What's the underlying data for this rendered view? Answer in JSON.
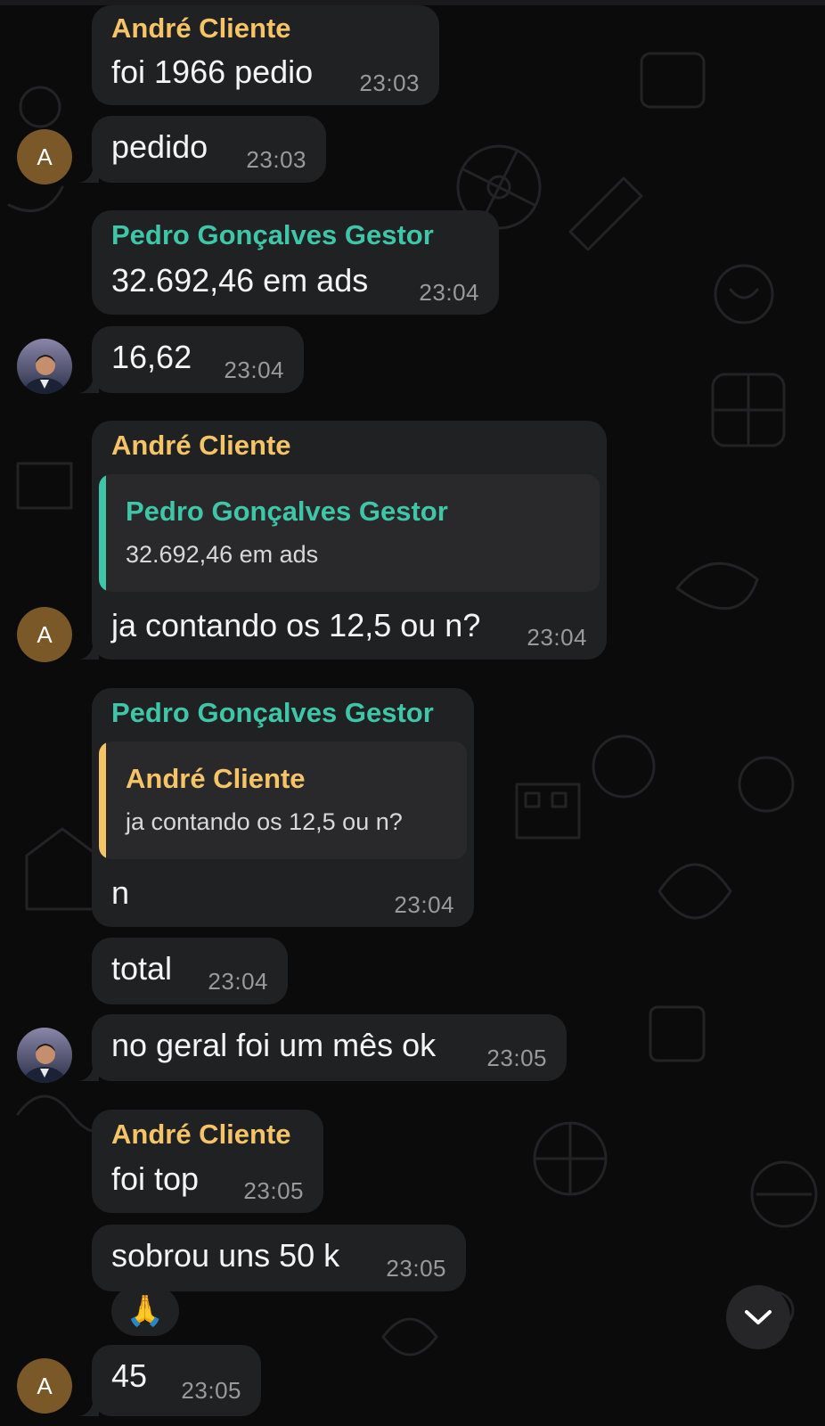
{
  "theme": {
    "bubble_color": "#202123",
    "andre_name_color": "#f5c466",
    "pedro_name_color": "#3fc6a9",
    "background_color": "#0b0b0c"
  },
  "avatars": {
    "andre": {
      "initial": "A",
      "color": "#7b5828"
    },
    "pedro": {
      "icon": "person-photo-icon"
    }
  },
  "messages": [
    {
      "sender": "André Cliente",
      "text": "foi 1966 pedio",
      "time": "23:03"
    },
    {
      "text": "pedido",
      "time": "23:03"
    },
    {
      "sender": "Pedro Gonçalves Gestor",
      "text": "32.692,46 em ads",
      "time": "23:04"
    },
    {
      "text": "16,62",
      "time": "23:04"
    },
    {
      "sender": "André Cliente",
      "reply_to": {
        "sender": "Pedro Gonçalves Gestor",
        "text": "32.692,46 em ads"
      },
      "text": "ja contando os 12,5 ou n?",
      "time": "23:04"
    },
    {
      "sender": "Pedro Gonçalves Gestor",
      "reply_to": {
        "sender": "André Cliente",
        "text": "ja contando os 12,5 ou n?"
      },
      "text": "n",
      "time": "23:04"
    },
    {
      "text": "total",
      "time": "23:04"
    },
    {
      "text": "no geral foi um mês ok",
      "time": "23:05"
    },
    {
      "sender": "André Cliente",
      "text": "foi top",
      "time": "23:05"
    },
    {
      "text": "sobrou uns 50 k",
      "time": "23:05"
    },
    {
      "reaction": "🙏"
    },
    {
      "text": "45",
      "time": "23:05"
    }
  ],
  "scroll_button": {
    "icon": "chevron-down-icon"
  }
}
